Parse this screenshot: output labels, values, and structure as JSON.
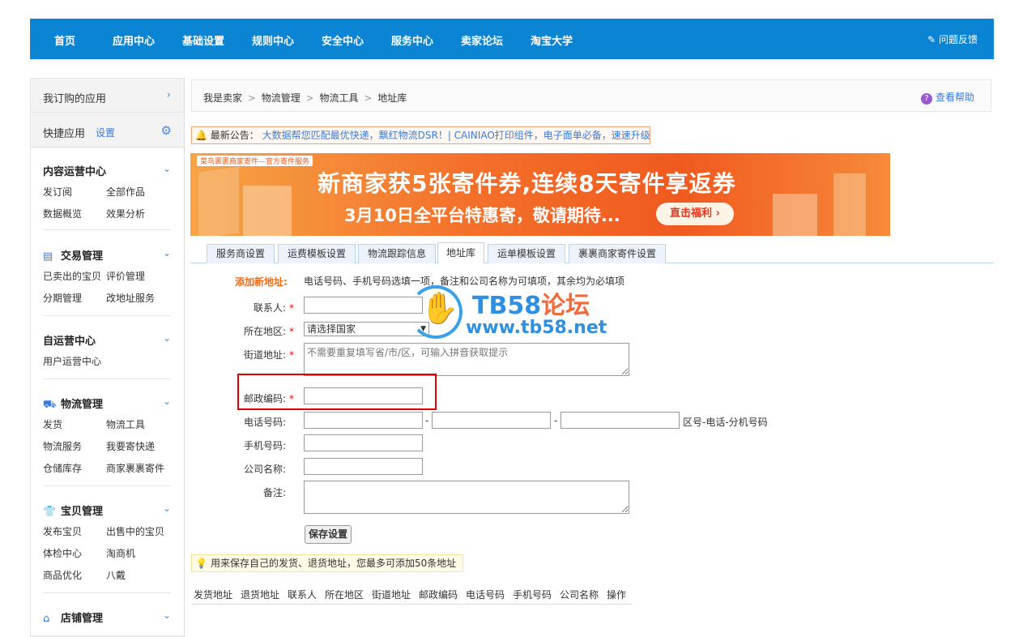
{
  "topnav": {
    "items": [
      "首页",
      "应用中心",
      "基础设置",
      "规则中心",
      "安全中心",
      "服务中心",
      "卖家论坛",
      "淘宝大学"
    ],
    "feedback": "问题反馈"
  },
  "sidebar": {
    "subscribed": "我订购的应用",
    "quick": "快捷应用",
    "quick_setting": "设置",
    "groups": [
      {
        "title": "内容运营中心",
        "links": [
          "发订阅",
          "全部作品",
          "数据概览",
          "效果分析"
        ]
      },
      {
        "title": "交易管理",
        "links": [
          "已卖出的宝贝",
          "评价管理",
          "分期管理",
          "改地址服务"
        ]
      },
      {
        "title": "自运营中心",
        "links": [
          "用户运营中心"
        ]
      },
      {
        "title": "物流管理",
        "links": [
          "发货",
          "物流工具",
          "物流服务",
          "我要寄快递",
          "仓储库存",
          "商家裹裹寄件"
        ]
      },
      {
        "title": "宝贝管理",
        "links": [
          "发布宝贝",
          "出售中的宝贝",
          "体检中心",
          "淘商机",
          "商品优化",
          "八戴"
        ]
      },
      {
        "title": "店铺管理",
        "links": []
      }
    ]
  },
  "breadcrumb": {
    "items": [
      "我是卖家",
      "物流管理",
      "物流工具",
      "地址库"
    ],
    "separator": ">",
    "help": "查看帮助"
  },
  "notice": {
    "title": "最新公告：",
    "text": "大数据帮您匹配最优快递，飘红物流DSR！| CAINIAO打印组件，电子面单必备，速速升级"
  },
  "banner": {
    "tag": "菜鸟裹裹商家寄件—官方寄件服务",
    "headline": "新商家获5张寄件券,连续8天寄件享返券",
    "subline": "3月10日全平台特惠寄，敬请期待...",
    "button": "直击福利 ›"
  },
  "tabs": [
    "服务商设置",
    "运费模板设置",
    "物流跟踪信息",
    "地址库",
    "运单模板设置",
    "裹裹商家寄件设置"
  ],
  "active_tab": "地址库",
  "form": {
    "section_title": "添加新地址:",
    "hint": "电话号码、手机号码选填一项，备注和公司名称为可填项，其余均为必填项",
    "contact_label": "联系人:",
    "region_label": "所在地区:",
    "region_value": "请选择国家",
    "street_label": "街道地址:",
    "street_placeholder": "不需要重复填写省/市/区，可输入拼音获取提示",
    "zip_label": "邮政编码:",
    "phone_label": "电话号码:",
    "phone_hint": "区号-电话-分机号码",
    "mobile_label": "手机号码:",
    "company_label": "公司名称:",
    "remark_label": "备注:",
    "required_mark": "*",
    "dash": "-",
    "save": "保存设置"
  },
  "tip": "用来保存自己的发货、退货地址，您最多可添加50条地址",
  "table_headers": [
    "发货地址",
    "退货地址",
    "联系人",
    "所在地区",
    "街道地址",
    "邮政编码",
    "电话号码",
    "手机号码",
    "公司名称",
    "操作"
  ],
  "watermark": {
    "line1_latin": "TB58",
    "line1_cn": "论坛",
    "line2": "www.tb58.net"
  },
  "colors": {
    "nav_bg": "#0b84d3",
    "link_blue": "#3a7ad5",
    "accent_orange": "#f06a1a",
    "highlight_red": "#e00000"
  }
}
